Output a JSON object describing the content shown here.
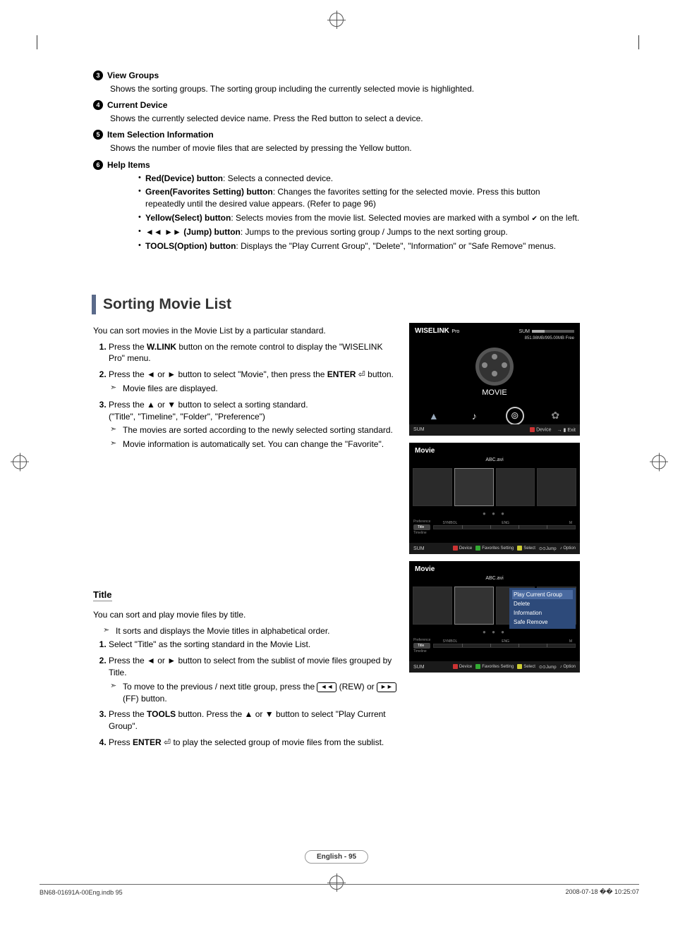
{
  "items": {
    "n3": {
      "num": "3",
      "title": "View Groups",
      "desc": "Shows the sorting groups. The sorting group including the currently selected movie is highlighted."
    },
    "n4": {
      "num": "4",
      "title": "Current Device",
      "desc": "Shows the currently selected device name. Press the Red button to select a device."
    },
    "n5": {
      "num": "5",
      "title": "Item Selection Information",
      "desc": "Shows the number of movie files that are selected by pressing the Yellow button."
    },
    "n6": {
      "num": "6",
      "title": "Help Items"
    }
  },
  "help_bullets": {
    "b1a": "Red(Device) button",
    "b1b": ": Selects a connected device.",
    "b2a": "Green(Favorites Setting) button",
    "b2b": ": Changes the favorites setting for the selected movie. Press this button repeatedly until the desired value appears. (Refer to page 96)",
    "b3a": "Yellow(Select) button",
    "b3b": ": Selects movies from the movie list. Selected movies are marked with a symbol ",
    "b3c": " on the left.",
    "b4a": "(Jump) button",
    "b4b": ": Jumps to the previous sorting group / Jumps to the next sorting group.",
    "b5a": "TOOLS(Option) button",
    "b5b": ": Displays the \"Play Current Group\", \"Delete\", \"Information\" or \"Safe Remove\" menus."
  },
  "section1": {
    "heading": "Sorting Movie List",
    "intro": "You can sort movies in the Movie List by a particular standard.",
    "s1a": "Press the ",
    "s1b": "W.LINK",
    "s1c": " button on the remote control to display the \"WISELINK Pro\" menu.",
    "s2a": "Press the ◄ or ► button to select \"Movie\", then press the ",
    "s2b": "ENTER",
    "s2c": " button.",
    "s2n1": "Movie files are displayed.",
    "s3a": "Press the ▲ or ▼ button to select a sorting standard.",
    "s3b": "(\"Title\", \"Timeline\", \"Folder\", \"Preference\")",
    "s3n1": "The movies are sorted according to the newly selected sorting standard.",
    "s3n2": "Movie information is automatically set. You can change the \"Favorite\"."
  },
  "section2": {
    "heading": "Title",
    "intro": "You can sort and play movie files by title.",
    "n1": "It sorts and displays the Movie titles in alphabetical order.",
    "s1": "Select \"Title\" as the sorting standard in the Movie List.",
    "s2": "Press the ◄ or ► button to select from the sublist of movie files grouped by Title.",
    "s2n1a": "To move to the previous / next title group, press the ",
    "s2n1b": " (REW) or ",
    "s2n1c": " (FF) button.",
    "s3a": "Press the ",
    "s3b": "TOOLS",
    "s3c": " button. Press the ▲ or ▼ button to select \"Play Current Group\".",
    "s4a": "Press ",
    "s4b": "ENTER",
    "s4c": " to play the selected group of movie files from the sublist."
  },
  "fig1": {
    "wiselink": "WISELINK",
    "pro": "Pro",
    "sum": "SUM",
    "free": "851.98MB/995.00MB Free",
    "movie": "MOVIE",
    "photo": "Photo",
    "music": "Music",
    "movie2": "Movie",
    "setup": "Setup",
    "foot_sum": "SUM",
    "device": "Device",
    "exit": "Exit"
  },
  "fig2": {
    "title": "Movie",
    "file": "ABC.avi",
    "pref": "Preference",
    "timeline": "Timeline",
    "titlelab": "Title",
    "symbol": "SYMBOL",
    "eng": "ENG",
    "m": "M",
    "foot_sum": "SUM",
    "device": "Device",
    "fav": "Favorites Setting",
    "select": "Select",
    "jump": "Jump",
    "option": "Option"
  },
  "fig3": {
    "title": "Movie",
    "file": "ABC.avi",
    "menu": {
      "m1": "Play Current Group",
      "m2": "Delete",
      "m3": "Information",
      "m4": "Safe Remove"
    },
    "pref": "Preference",
    "timeline": "Timeline",
    "titlelab": "Title",
    "symbol": "SYMBOL",
    "eng": "ENG",
    "m": "M",
    "foot_sum": "SUM",
    "device": "Device",
    "fav": "Favorites Setting",
    "select": "Select",
    "jump": "Jump",
    "option": "Option"
  },
  "pagenum": "English - 95",
  "footer_left": "BN68-01691A-00Eng.indb   95",
  "footer_right": "2008-07-18   �� 10:25:07",
  "icons": {
    "check": "✔",
    "rew": "◄◄",
    "ff": "►►",
    "enter": "⏎"
  }
}
